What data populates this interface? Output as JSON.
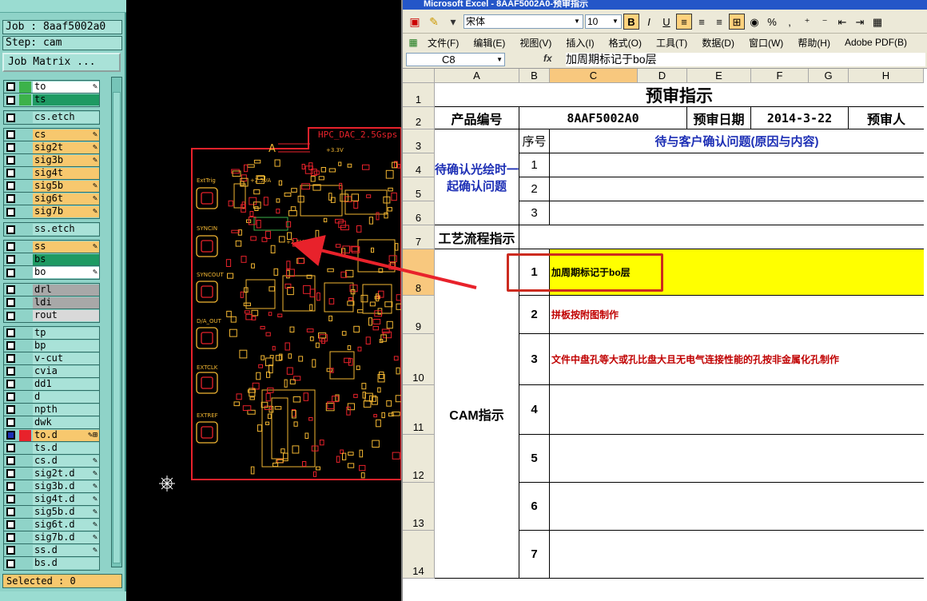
{
  "cam": {
    "job_label": "Job : 8aaf5002a0",
    "step_label": "Step: cam",
    "matrix_button": "Job Matrix ...",
    "selected_status": "Selected : 0",
    "layer_groups": [
      [
        {
          "name": "to",
          "swatch": "#3cb24a",
          "fill": "#ffffff",
          "mark": "✎"
        },
        {
          "name": "ts",
          "swatch": "#3cb24a",
          "fill": "#1e9a63",
          "mark": ""
        }
      ],
      [
        {
          "name": "cs.etch",
          "swatch": "",
          "fill": "#a9e2d8",
          "mark": ""
        }
      ],
      [
        {
          "name": "cs",
          "swatch": "",
          "fill": "#f7c86e",
          "mark": "✎"
        },
        {
          "name": "sig2t",
          "swatch": "",
          "fill": "#f7c86e",
          "mark": "✎"
        },
        {
          "name": "sig3b",
          "swatch": "",
          "fill": "#f7c86e",
          "mark": "✎"
        },
        {
          "name": "sig4t",
          "swatch": "",
          "fill": "#f7c86e",
          "mark": ""
        },
        {
          "name": "sig5b",
          "swatch": "",
          "fill": "#f7c86e",
          "mark": "✎"
        },
        {
          "name": "sig6t",
          "swatch": "",
          "fill": "#f7c86e",
          "mark": "✎"
        },
        {
          "name": "sig7b",
          "swatch": "",
          "fill": "#f7c86e",
          "mark": "✎"
        }
      ],
      [
        {
          "name": "ss.etch",
          "swatch": "",
          "fill": "#a9e2d8",
          "mark": ""
        }
      ],
      [
        {
          "name": "ss",
          "swatch": "",
          "fill": "#f7c86e",
          "mark": "✎"
        },
        {
          "name": "bs",
          "swatch": "",
          "fill": "#1e9a63",
          "mark": ""
        },
        {
          "name": "bo",
          "swatch": "",
          "fill": "#ffffff",
          "mark": "✎"
        }
      ],
      [
        {
          "name": "drl",
          "swatch": "",
          "fill": "#a8a8a8",
          "mark": ""
        },
        {
          "name": "ldi",
          "swatch": "",
          "fill": "#a8a8a8",
          "mark": ""
        },
        {
          "name": "rout",
          "swatch": "",
          "fill": "#d9d9d9",
          "mark": ""
        }
      ],
      [
        {
          "name": "tp",
          "swatch": "",
          "fill": "#a9e2d8",
          "mark": ""
        },
        {
          "name": "bp",
          "swatch": "",
          "fill": "#a9e2d8",
          "mark": ""
        },
        {
          "name": "v-cut",
          "swatch": "",
          "fill": "#a9e2d8",
          "mark": ""
        },
        {
          "name": "cvia",
          "swatch": "",
          "fill": "#a9e2d8",
          "mark": ""
        },
        {
          "name": "dd1",
          "swatch": "",
          "fill": "#a9e2d8",
          "mark": ""
        },
        {
          "name": "d",
          "swatch": "",
          "fill": "#a9e2d8",
          "mark": ""
        },
        {
          "name": "npth",
          "swatch": "",
          "fill": "#a9e2d8",
          "mark": ""
        },
        {
          "name": "dwk",
          "swatch": "",
          "fill": "#a9e2d8",
          "mark": ""
        },
        {
          "name": "to.d",
          "swatch": "#e8222b",
          "fill": "#f7c86e",
          "mark": "✎⊞",
          "active": true
        },
        {
          "name": "ts.d",
          "swatch": "",
          "fill": "#a9e2d8",
          "mark": ""
        },
        {
          "name": "cs.d",
          "swatch": "",
          "fill": "#a9e2d8",
          "mark": "✎"
        },
        {
          "name": "sig2t.d",
          "swatch": "",
          "fill": "#a9e2d8",
          "mark": "✎"
        },
        {
          "name": "sig3b.d",
          "swatch": "",
          "fill": "#a9e2d8",
          "mark": "✎"
        },
        {
          "name": "sig4t.d",
          "swatch": "",
          "fill": "#a9e2d8",
          "mark": "✎"
        },
        {
          "name": "sig5b.d",
          "swatch": "",
          "fill": "#a9e2d8",
          "mark": "✎"
        },
        {
          "name": "sig6t.d",
          "swatch": "",
          "fill": "#a9e2d8",
          "mark": "✎"
        },
        {
          "name": "sig7b.d",
          "swatch": "",
          "fill": "#a9e2d8",
          "mark": "✎"
        },
        {
          "name": "ss.d",
          "swatch": "",
          "fill": "#a9e2d8",
          "mark": "✎"
        },
        {
          "name": "bs.d",
          "swatch": "",
          "fill": "#a9e2d8",
          "mark": ""
        }
      ]
    ]
  },
  "pcb": {
    "board_title": "HPC_DAC_2.5Gsps",
    "board_letter": "A",
    "labels": [
      "ExtTrig",
      "SYNCIN",
      "SYNCOUT",
      "D/A_OUT",
      "EXTCLK",
      "EXTREF"
    ],
    "voltages": [
      "+2.5VA",
      "+3.3V",
      "+2.5VA"
    ]
  },
  "excel": {
    "title": "Microsoft Excel - 8AAF5002A0-预审指示",
    "font_name": "宋体",
    "font_size": "10",
    "menus": [
      "文件(F)",
      "编辑(E)",
      "视图(V)",
      "插入(I)",
      "格式(O)",
      "工具(T)",
      "数据(D)",
      "窗口(W)",
      "帮助(H)",
      "Adobe PDF(B)"
    ],
    "name_box": "C8",
    "fx": "fx",
    "formula": "加周期标记于bo层",
    "columns": [
      "A",
      "B",
      "C",
      "D",
      "E",
      "F",
      "G",
      "H"
    ],
    "rows": [
      "1",
      "2",
      "3",
      "4",
      "5",
      "6",
      "7",
      "8",
      "9",
      "10",
      "11",
      "12",
      "13",
      "14"
    ],
    "sheet": {
      "title": "预审指示",
      "product_no_label": "产品编号",
      "product_no": "8AAF5002A0",
      "review_date_label": "预审日期",
      "review_date": "2014-3-22",
      "reviewer_label": "预审人",
      "pending_label": "待确认光绘时一起确认问题",
      "seq_label": "序号",
      "question_header": "待与客户确认问题(原因与内容)",
      "pending_seq": [
        "1",
        "2",
        "3"
      ],
      "process_label": "工艺流程指示",
      "cam_label": "CAM指示",
      "cam_items": [
        {
          "seq": "1",
          "text": "加周期标记于bo层"
        },
        {
          "seq": "2",
          "text": "拼板按附图制作"
        },
        {
          "seq": "3",
          "text": "文件中盘孔等大或孔比盘大且无电气连接性能的孔按非金属化孔制作"
        },
        {
          "seq": "4",
          "text": ""
        },
        {
          "seq": "5",
          "text": ""
        },
        {
          "seq": "6",
          "text": ""
        },
        {
          "seq": "7",
          "text": ""
        }
      ],
      "highlight_color": "#ffff00"
    }
  },
  "colors": {
    "cam_bg": "#8fd3c8",
    "annotation_red": "#cc2a1f",
    "pcb_outline": "#e8222b",
    "pcb_silk": "#f2b632"
  }
}
